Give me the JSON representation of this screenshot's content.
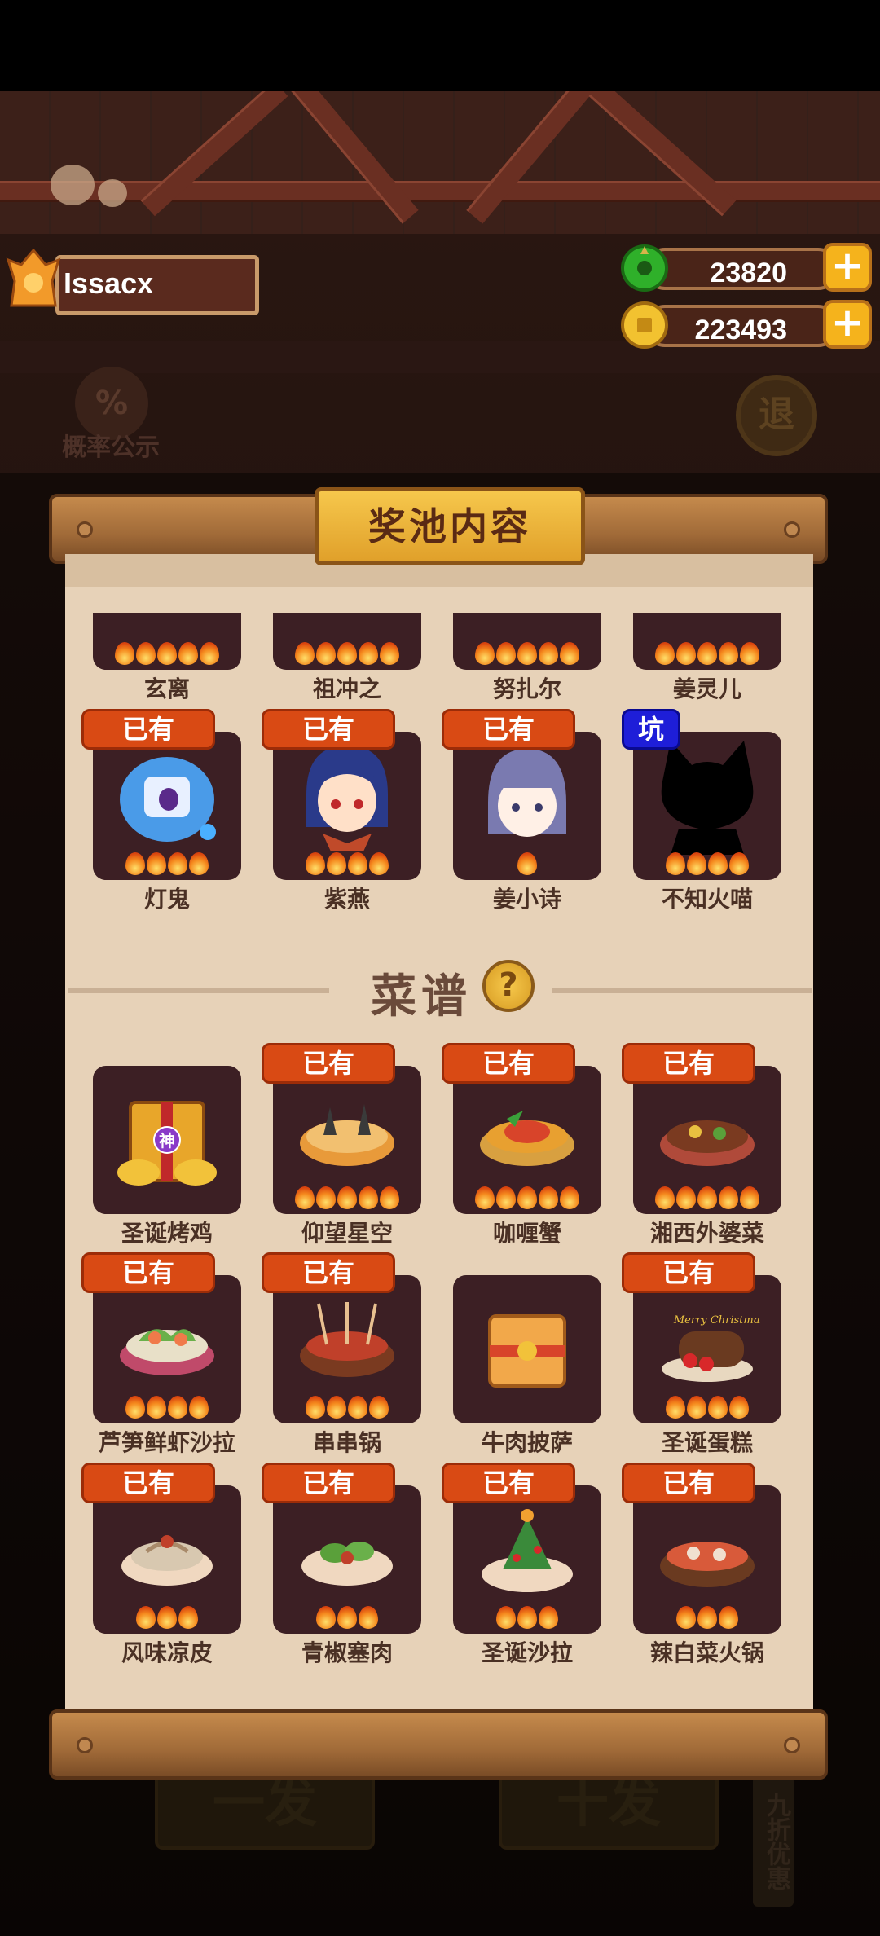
{
  "player": {
    "name": "Issacx"
  },
  "currency": {
    "jade": {
      "value": "23820",
      "plus": "+"
    },
    "coin": {
      "value": "223493",
      "plus": "+"
    }
  },
  "background": {
    "probability_label": "概率公示",
    "probability_icon": "%",
    "back_label": "退",
    "single_draw": "一发",
    "ten_draw": "十发",
    "discount_tag": "九折优惠"
  },
  "panel": {
    "title": "奖池内容"
  },
  "owned_badge": "已有",
  "pit_badge": "坑",
  "characters_partial": [
    {
      "name": "玄离",
      "stars": 5
    },
    {
      "name": "祖冲之",
      "stars": 5
    },
    {
      "name": "努扎尔",
      "stars": 5
    },
    {
      "name": "姜灵儿",
      "stars": 5
    }
  ],
  "characters": [
    {
      "name": "灯鬼",
      "stars": 4,
      "owned": true
    },
    {
      "name": "紫燕",
      "stars": 4,
      "owned": true
    },
    {
      "name": "姜小诗",
      "stars": 1,
      "owned": true
    },
    {
      "name": "不知火喵",
      "stars": 4,
      "owned": false,
      "pit": true
    }
  ],
  "recipes_section": {
    "title": "菜谱",
    "help_icon": "?"
  },
  "recipes": [
    {
      "name": "圣诞烤鸡",
      "stars": 0,
      "owned": false,
      "tag": "神"
    },
    {
      "name": "仰望星空",
      "stars": 5,
      "owned": true
    },
    {
      "name": "咖喱蟹",
      "stars": 5,
      "owned": true
    },
    {
      "name": "湘西外婆菜",
      "stars": 5,
      "owned": true
    },
    {
      "name": "芦笋鲜虾沙拉",
      "stars": 4,
      "owned": true
    },
    {
      "name": "串串锅",
      "stars": 4,
      "owned": true
    },
    {
      "name": "牛肉披萨",
      "stars": 0,
      "owned": false
    },
    {
      "name": "圣诞蛋糕",
      "stars": 4,
      "owned": true,
      "art_text": "Merry Christmas"
    },
    {
      "name": "风味凉皮",
      "stars": 3,
      "owned": true
    },
    {
      "name": "青椒塞肉",
      "stars": 3,
      "owned": true
    },
    {
      "name": "圣诞沙拉",
      "stars": 3,
      "owned": true
    },
    {
      "name": "辣白菜火锅",
      "stars": 3,
      "owned": true
    }
  ]
}
